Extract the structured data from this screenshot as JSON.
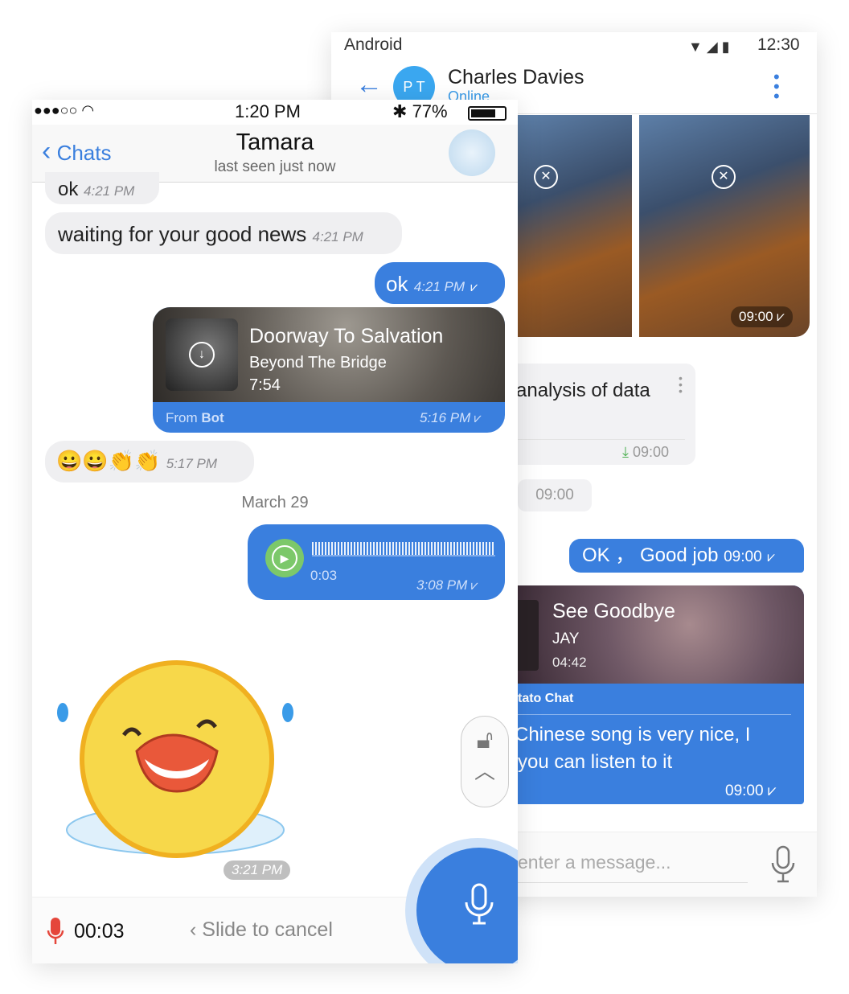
{
  "android": {
    "status": {
      "carrier": "Android",
      "time": "12:30"
    },
    "header": {
      "avatar_initials": "P T",
      "name": "Charles Davies",
      "status": "Online"
    },
    "photos": [
      {
        "time": "09:00"
      }
    ],
    "messages": {
      "file_text": "analysis of data",
      "file_time": "09:00",
      "pill_time": "09:00",
      "ok_text": "OK ， Good job",
      "ok_time": "09:00",
      "music": {
        "title": "See Goodbye",
        "artist": "JAY",
        "duration": "04:42",
        "from": "tato Chat",
        "text_line1": "Chinese song is very nice, I",
        "text_line2": "you can listen to it",
        "time": "09:00"
      }
    },
    "input": {
      "placeholder": "enter a message..."
    },
    "colors": {
      "accent": "#3a7fde"
    }
  },
  "ios": {
    "status": {
      "time": "1:20 PM",
      "battery": "77%"
    },
    "header": {
      "back": "Chats",
      "name": "Tamara",
      "status": "last seen just now"
    },
    "messages": {
      "m1": {
        "text": "ok",
        "time": "4:21 PM"
      },
      "m2": {
        "text": "waiting for your good news",
        "time": "4:21 PM"
      },
      "m3": {
        "text": "ok",
        "time": "4:21 PM"
      },
      "music": {
        "title": "Doorway To Salvation",
        "artist": "Beyond The Bridge",
        "duration": "7:54",
        "from_prefix": "From ",
        "from_name": "Bot",
        "time": "5:16 PM"
      },
      "emoji": {
        "text": "😀😀👏👏",
        "time": "5:17 PM"
      },
      "date": "March 29",
      "voice": {
        "duration": "0:03",
        "time": "3:08 PM"
      },
      "sticker": {
        "time": "3:21 PM"
      }
    },
    "recording": {
      "timer": "00:03",
      "slide": "Slide to cancel"
    }
  }
}
